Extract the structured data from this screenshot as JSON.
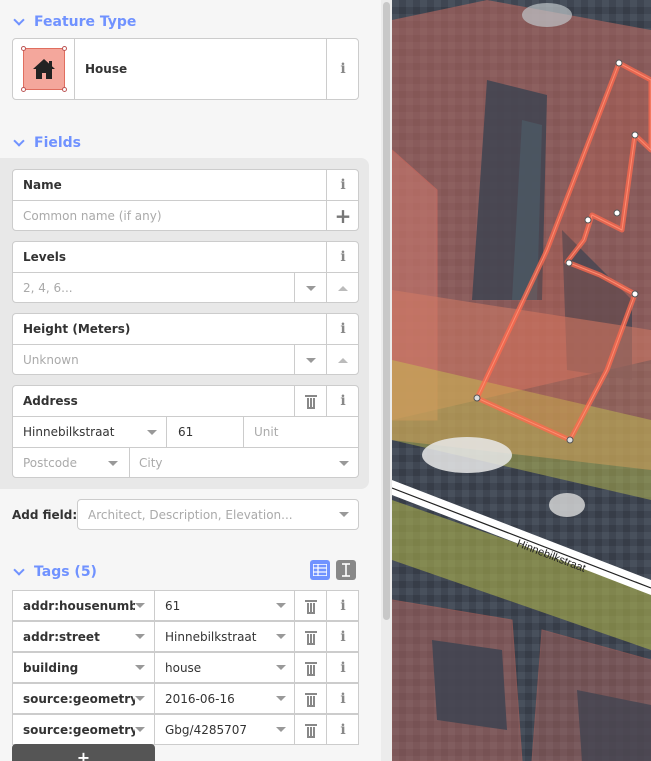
{
  "feature_type": {
    "heading": "Feature Type",
    "preset_name": "House",
    "icon": "house-icon"
  },
  "fields": {
    "heading": "Fields",
    "name": {
      "label": "Name",
      "placeholder": "Common name (if any)"
    },
    "levels": {
      "label": "Levels",
      "placeholder": "2, 4, 6..."
    },
    "height": {
      "label": "Height (Meters)",
      "placeholder": "Unknown"
    },
    "address": {
      "label": "Address",
      "street": "Hinnebilkstraat",
      "housenumber": "61",
      "unit_placeholder": "Unit",
      "postcode_placeholder": "Postcode",
      "city_placeholder": "City"
    },
    "add_field": {
      "label": "Add field:",
      "placeholder": "Architect, Description, Elevation..."
    }
  },
  "tags": {
    "heading": "Tags (5)",
    "rows": [
      {
        "key": "addr:housenumber",
        "value": "61"
      },
      {
        "key": "addr:street",
        "value": "Hinnebilkstraat"
      },
      {
        "key": "building",
        "value": "house"
      },
      {
        "key": "source:geometry:date",
        "value": "2016-06-16"
      },
      {
        "key": "source:geometry:ref",
        "value": "Gbg/4285707"
      }
    ],
    "add_label": "+"
  },
  "map": {
    "street_label": "Hinnebilkstraat"
  },
  "colors": {
    "accent": "#7092ff",
    "selected": "#ff6a4d",
    "building_fill": "#e06e5f",
    "road_yellow": "#c8c850"
  }
}
